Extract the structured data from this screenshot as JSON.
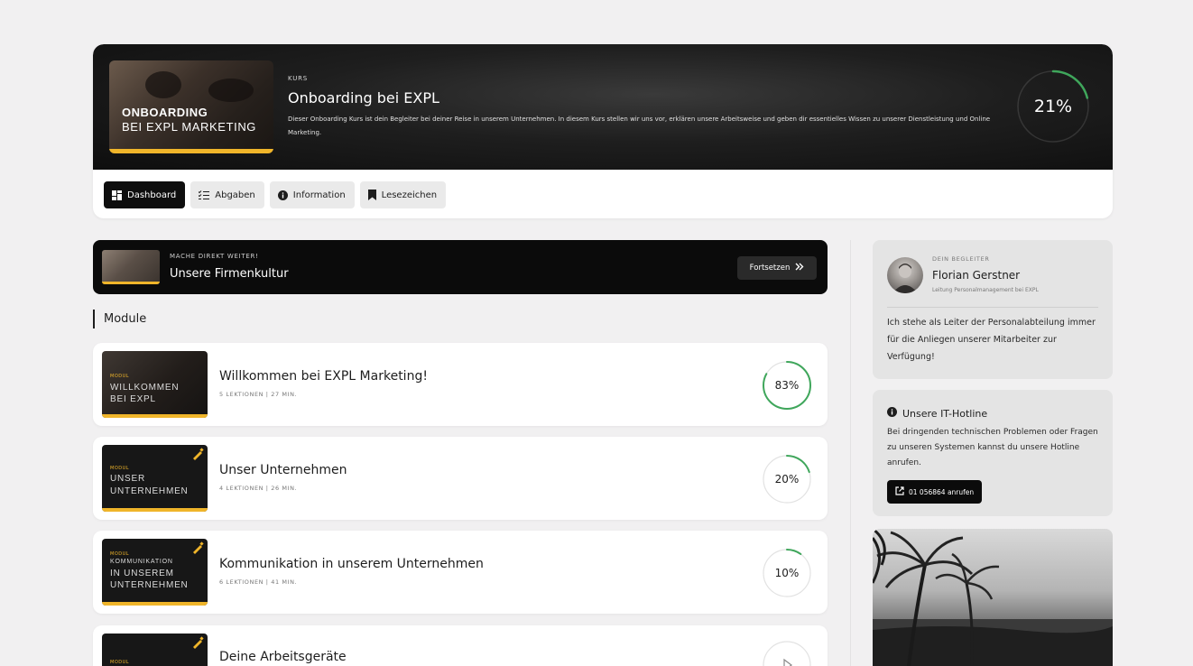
{
  "course": {
    "thumb_line1": "ONBOARDING",
    "thumb_line2": "BEI EXPL MARKETING",
    "kicker": "KURS",
    "title": "Onboarding bei EXPL",
    "description": "Dieser Onboarding Kurs ist dein Begleiter bei deiner Reise in unserem Unternehmen. In diesem Kurs stellen wir uns vor, erklären unsere Arbeitsweise und geben dir essentielles Wissen zu unserer Dienstleistung und Online Marketing.",
    "progress_label": "21%",
    "progress": 0.21
  },
  "tabs": [
    {
      "label": "Dashboard",
      "icon": "dashboard-icon",
      "active": true
    },
    {
      "label": "Abgaben",
      "icon": "checklist-icon",
      "active": false
    },
    {
      "label": "Information",
      "icon": "info-icon",
      "active": false
    },
    {
      "label": "Lesezeichen",
      "icon": "bookmark-icon",
      "active": false
    }
  ],
  "continue": {
    "kicker": "MACHE DIREKT WEITER!",
    "title": "Unsere Firmenkultur",
    "button_label": "Fortsetzen"
  },
  "modules_title": "Module",
  "modules": [
    {
      "thumb_kicker": "MODUL",
      "thumb_line1": "WILLKOMMEN",
      "thumb_line2": "BEI EXPL",
      "title": "Willkommen bei EXPL Marketing!",
      "meta": "5 LEKTIONEN | 27 MIN.",
      "progress_label": "83%",
      "progress": 0.83
    },
    {
      "thumb_kicker": "MODUL",
      "thumb_line1": "UNSER",
      "thumb_line2": "UNTERNEHMEN",
      "title": "Unser Unternehmen",
      "meta": "4 LEKTIONEN | 26 MIN.",
      "progress_label": "20%",
      "progress": 0.2
    },
    {
      "thumb_kicker": "MODUL",
      "thumb_line0": "KOMMUNIKATION",
      "thumb_line1": "IN UNSEREM",
      "thumb_line2": "UNTERNEHMEN",
      "title": "Kommunikation in unserem Unternehmen",
      "meta": "6 LEKTIONEN | 41 MIN.",
      "progress_label": "10%",
      "progress": 0.1
    },
    {
      "thumb_kicker": "MODUL",
      "title": "Deine Arbeitsgeräte",
      "progress": 0
    }
  ],
  "mentor": {
    "kicker": "DEIN BEGLEITER",
    "name": "Florian Gerstner",
    "role": "Leitung Personalmanagement bei EXPL",
    "text": "Ich stehe als Leiter der Personalabteilung immer für die Anliegen unserer Mitarbeiter zur Verfügung!"
  },
  "hotline": {
    "title": "Unsere IT-Hotline",
    "text": "Bei dringenden technischen Problemen oder Fragen zu unseren Systemen kannst du unsere Hotline anrufen.",
    "button_label": "01 056864 anrufen"
  },
  "colors": {
    "accent_yellow": "#f0b52a",
    "progress_green": "#3fa65b",
    "dark": "#0b0b0b"
  }
}
